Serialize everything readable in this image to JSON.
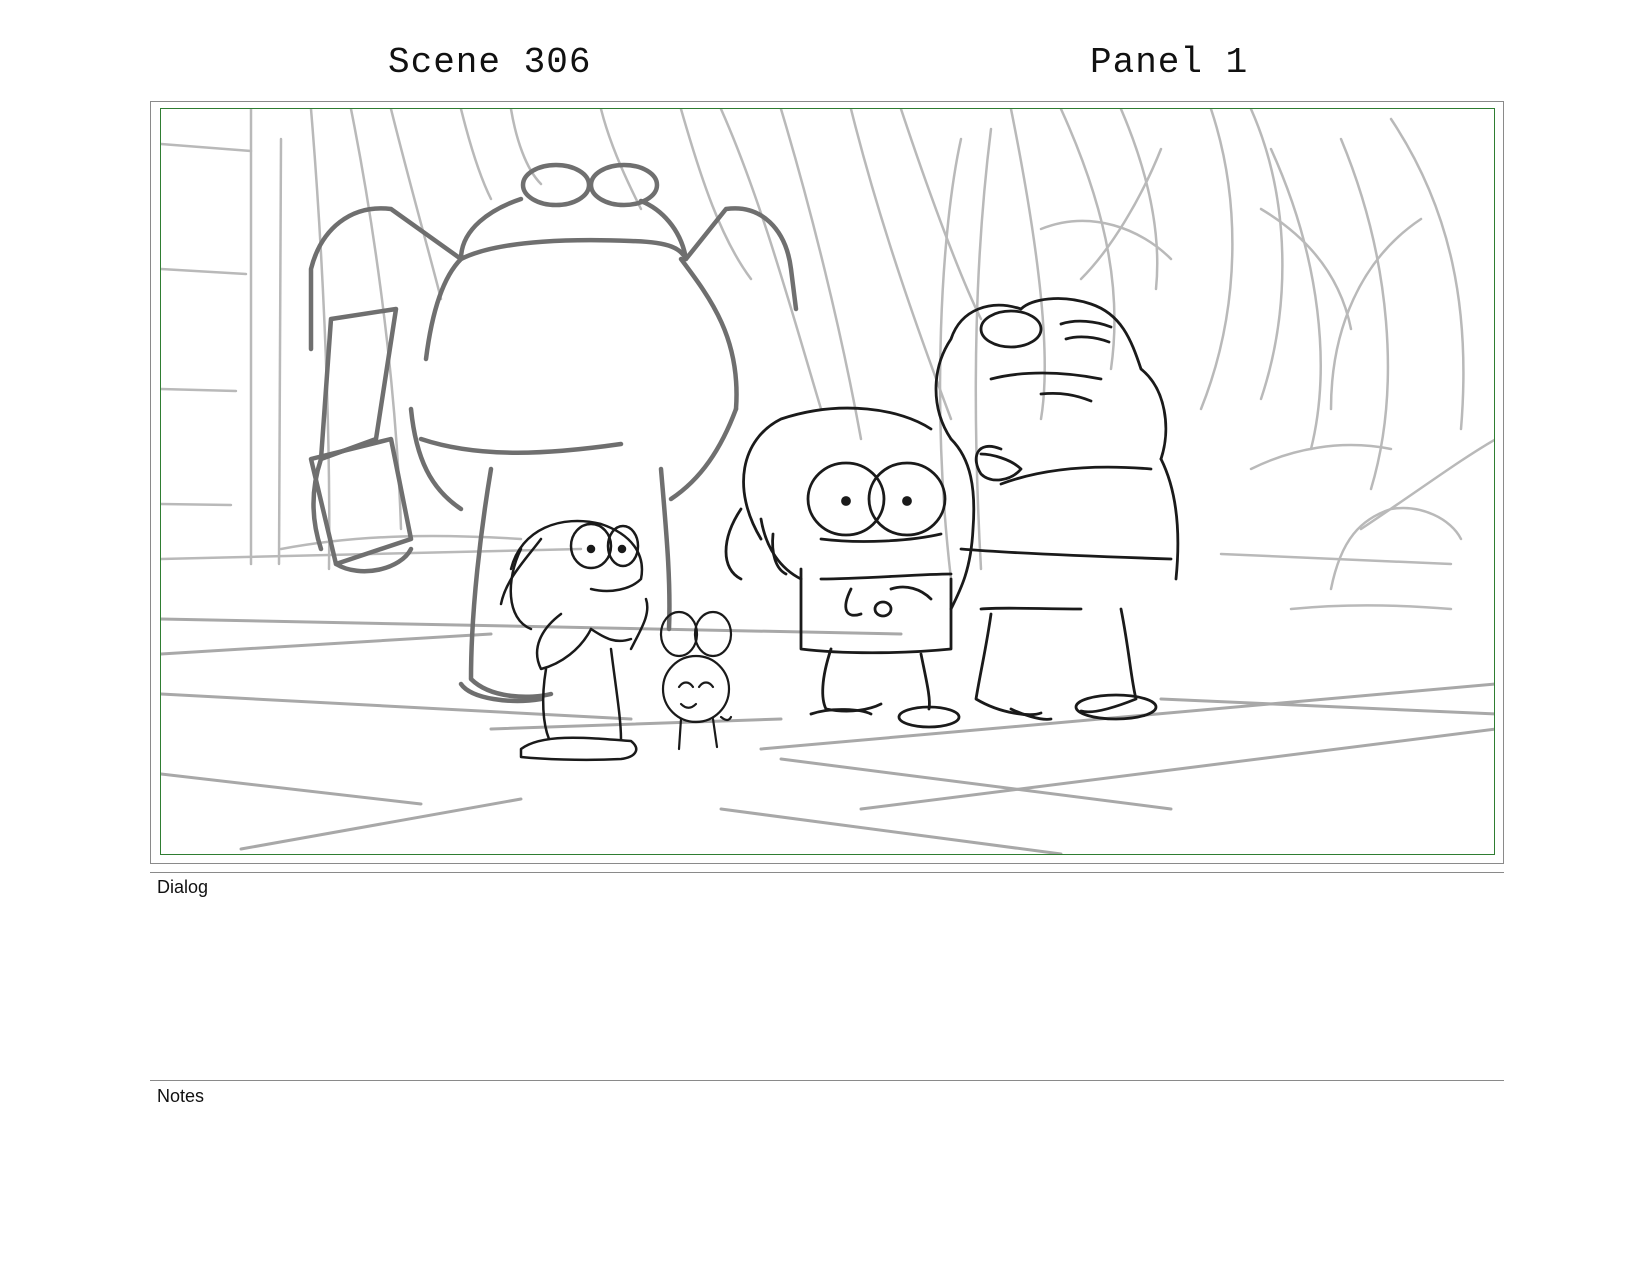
{
  "header": {
    "scene_label": "Scene 306",
    "panel_label": "Panel 1"
  },
  "storyboard_panel": {
    "artwork_icon": "storyboard-sketch-artwork",
    "border_color": "#2f7d32",
    "line_color_foreground": "#111111",
    "line_color_background": "#b8b8b8"
  },
  "dialog": {
    "label": "Dialog",
    "text": ""
  },
  "notes": {
    "label": "Notes",
    "text": ""
  }
}
